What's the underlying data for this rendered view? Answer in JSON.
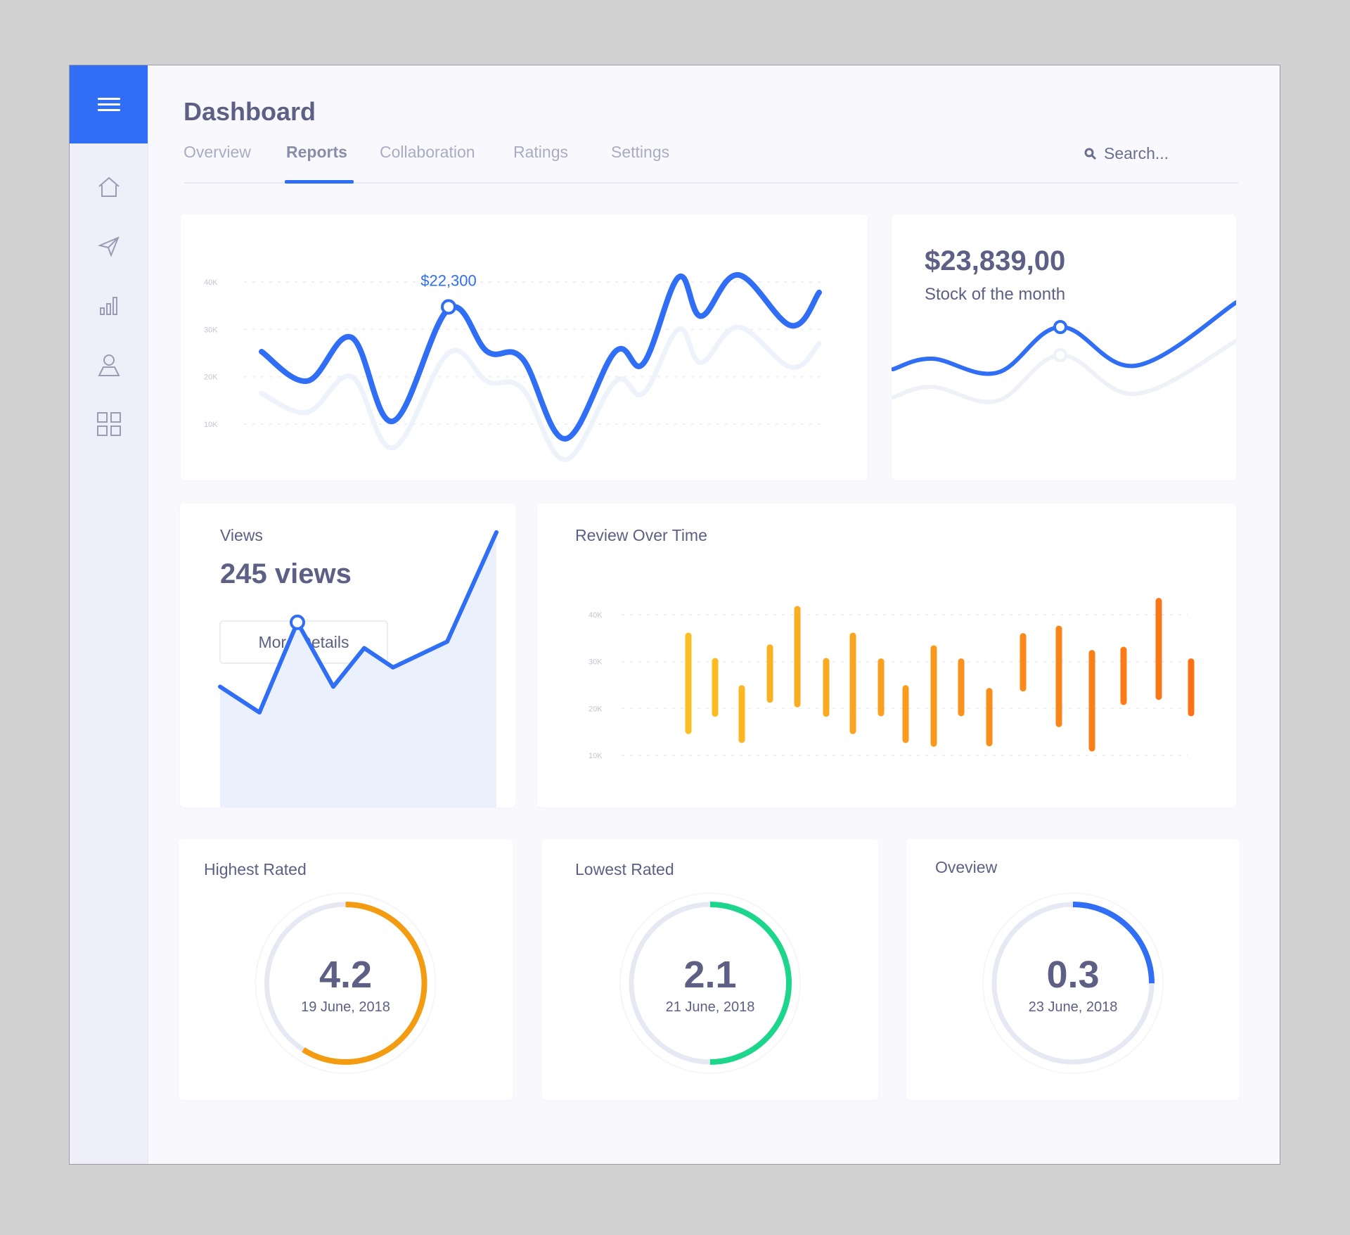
{
  "sidebar": {
    "menu_icon": "hamburger-menu-icon",
    "items": [
      {
        "icon": "home-icon"
      },
      {
        "icon": "paper-plane-icon"
      },
      {
        "icon": "bar-chart-icon"
      },
      {
        "icon": "user-icon"
      },
      {
        "icon": "grid-icon"
      }
    ]
  },
  "header": {
    "title": "Dashboard",
    "tabs": [
      {
        "label": "Overview",
        "active": false
      },
      {
        "label": "Reports",
        "active": true
      },
      {
        "label": "Collaboration",
        "active": false
      },
      {
        "label": "Ratings",
        "active": false
      },
      {
        "label": "Settings",
        "active": false
      }
    ],
    "search": {
      "placeholder": "Search...",
      "icon": "search-icon"
    }
  },
  "colors": {
    "accent": "#2f6ef5",
    "text": "#5d5f85",
    "orange": "#f39c12",
    "green": "#1dd68c",
    "bar_gradient_start": "#fbbf24",
    "bar_gradient_end": "#f97316"
  },
  "chart_data": [
    {
      "id": "revenue",
      "type": "line",
      "title": "",
      "ylabel": "",
      "yticks": [
        "10K",
        "20K",
        "30K",
        "40K"
      ],
      "ylim": [
        10000,
        40000
      ],
      "grid": true,
      "tooltip": {
        "label": "$22,300",
        "point_index": 4
      },
      "series": [
        {
          "name": "current",
          "values": [
            25300,
            19100,
            28300,
            10600,
            34300,
            25300,
            23800,
            6900,
            25300,
            22800,
            41000,
            32800,
            41500,
            30800,
            37800
          ]
        },
        {
          "name": "previous",
          "values": [
            16500,
            12500,
            20000,
            5000,
            25000,
            19000,
            17500,
            2500,
            19000,
            16500,
            30000,
            23000,
            30500,
            22000,
            27000
          ]
        }
      ]
    },
    {
      "id": "stock",
      "type": "line",
      "title": "Stock of the month",
      "highlight_value": "$23,839,00",
      "marker_index": 3,
      "series": [
        {
          "name": "current",
          "values": [
            22,
            25,
            21,
            34,
            23,
            41
          ]
        },
        {
          "name": "previous",
          "values": [
            14,
            17,
            13,
            26,
            15,
            30
          ]
        }
      ]
    },
    {
      "id": "views",
      "type": "area",
      "title": "Views",
      "marker_index": 2,
      "series": [
        {
          "name": "views",
          "values": [
            12,
            10,
            17,
            12,
            15,
            13.5,
            15.5,
            24
          ]
        }
      ]
    },
    {
      "id": "review",
      "type": "bar",
      "title": "Review Over Time",
      "yticks": [
        "10K",
        "20K",
        "30K",
        "40K"
      ],
      "ylim": [
        10000,
        40000
      ],
      "grid": true,
      "ranges": [
        [
          15200,
          35500
        ],
        [
          18900,
          30100
        ],
        [
          13300,
          24300
        ],
        [
          21900,
          33000
        ],
        [
          20900,
          41200
        ],
        [
          18900,
          30100
        ],
        [
          15200,
          35500
        ],
        [
          19000,
          30000
        ],
        [
          13300,
          24300
        ],
        [
          12500,
          32800
        ],
        [
          19000,
          30000
        ],
        [
          12600,
          23700
        ],
        [
          24300,
          35400
        ],
        [
          16700,
          37000
        ],
        [
          11500,
          31800
        ],
        [
          21400,
          32500
        ],
        [
          22500,
          42900
        ],
        [
          19000,
          30000
        ]
      ]
    }
  ],
  "views": {
    "label": "Views",
    "count": "245 views",
    "button": "More Details"
  },
  "stock": {
    "amount": "$23,839,00",
    "label": "Stock of the month"
  },
  "review": {
    "title": "Review Over Time"
  },
  "ratings": [
    {
      "title": "Highest Rated",
      "value": "4.2",
      "date": "19 June, 2018",
      "progress": 0.59,
      "color": "#f39c12"
    },
    {
      "title": "Lowest Rated",
      "value": "2.1",
      "date": "21 June, 2018",
      "progress": 0.5,
      "color": "#1dd68c"
    },
    {
      "title": "Oveview",
      "value": "0.3",
      "date": "23 June, 2018",
      "progress": 0.25,
      "color": "#2f6ef5"
    }
  ]
}
